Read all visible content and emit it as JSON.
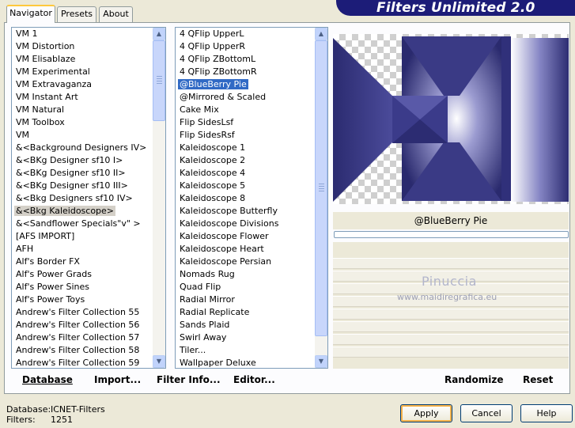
{
  "banner": {
    "title": "Filters Unlimited 2.0"
  },
  "tabs": [
    {
      "label": "Navigator"
    },
    {
      "label": "Presets"
    },
    {
      "label": "About"
    }
  ],
  "categories": {
    "items": [
      "VM 1",
      "VM Distortion",
      "VM Elisablaze",
      "VM Experimental",
      "VM Extravaganza",
      "VM Instant Art",
      "VM Natural",
      "VM Toolbox",
      "VM",
      "&<Background Designers IV>",
      "&<BKg Designer sf10 I>",
      "&<BKg Designer sf10 II>",
      "&<BKg Designer sf10 III>",
      "&<Bkg Designers sf10 IV>",
      "&<Bkg Kaleidoscope>",
      "&<Sandflower Specials\"v\" >",
      "[AFS IMPORT]",
      "AFH",
      "Alf's Border FX",
      "Alf's Power Grads",
      "Alf's Power Sines",
      "Alf's Power Toys",
      "Andrew's Filter Collection 55",
      "Andrew's Filter Collection 56",
      "Andrew's Filter Collection 57",
      "Andrew's Filter Collection 58",
      "Andrew's Filter Collection 59"
    ],
    "highlighted_index": 14
  },
  "filters": {
    "items": [
      "4 QFlip UpperL",
      "4 QFlip UpperR",
      "4 QFlip ZBottomL",
      "4 QFlip ZBottomR",
      "@BlueBerry Pie",
      "@Mirrored & Scaled",
      "Cake Mix",
      "Flip SidesLsf",
      "Flip SidesRsf",
      "Kaleidoscope 1",
      "Kaleidoscope 2",
      "Kaleidoscope 4",
      "Kaleidoscope 5",
      "Kaleidoscope 8",
      "Kaleidoscope Butterfly",
      "Kaleidoscope Divisions",
      "Kaleidoscope Flower",
      "Kaleidoscope Heart",
      "Kaleidoscope Persian",
      "Nomads Rug",
      "Quad Flip",
      "Radial Mirror",
      "Radial Replicate",
      "Sands Plaid",
      "Swirl Away",
      "Tiler...",
      "Wallpaper Deluxe"
    ],
    "selected_index": 4
  },
  "left_buttons": {
    "database": "Database",
    "import": "Import...",
    "filter_info": "Filter Info...",
    "editor": "Editor..."
  },
  "preview": {
    "filter_name": "@BlueBerry Pie",
    "progress_percent": 0
  },
  "watermark": {
    "line1": "Pinuccia",
    "line2": "www.maidiregrafica.eu"
  },
  "right_buttons": {
    "randomize": "Randomize",
    "reset": "Reset"
  },
  "status": {
    "database_label": "Database:",
    "database_value": "ICNET-Filters",
    "filters_label": "Filters:",
    "filters_value": "1251"
  },
  "dialog_buttons": {
    "apply": "Apply",
    "cancel": "Cancel",
    "help": "Help"
  },
  "colors": {
    "banner": "#1c1c78",
    "selection": "#316ac5",
    "preview_dark": "#2b2b70"
  }
}
